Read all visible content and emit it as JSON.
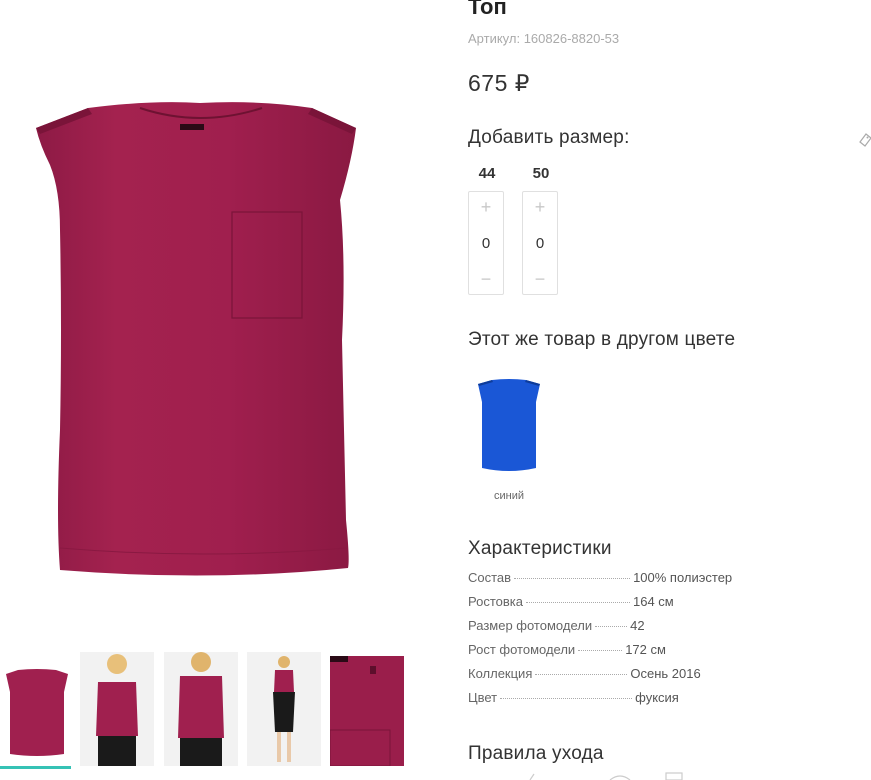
{
  "product": {
    "title": "Топ",
    "sku": "Артикул: 160826-8820-53",
    "price": "675 ₽"
  },
  "sizes": {
    "heading": "Добавить размер:",
    "items": [
      {
        "label": "44",
        "plus": "+",
        "value": "0",
        "minus": "−"
      },
      {
        "label": "50",
        "plus": "+",
        "value": "0",
        "minus": "−"
      }
    ]
  },
  "other_colors": {
    "heading": "Этот же товар в другом цвете",
    "items": [
      {
        "label": "синий",
        "color": "#1a57d6"
      }
    ]
  },
  "specs": {
    "heading": "Характеристики",
    "rows": [
      {
        "name": "Состав",
        "value": "100% полиэстер"
      },
      {
        "name": "Ростовка",
        "value": "164 см"
      },
      {
        "name": "Размер фотомодели",
        "value": "42"
      },
      {
        "name": "Рост фотомодели",
        "value": "172 см"
      },
      {
        "name": "Коллекция",
        "value": "Осень 2016"
      },
      {
        "name": "Цвет",
        "value": "фуксия"
      }
    ]
  },
  "care": {
    "heading": "Правила ухода"
  },
  "colors": {
    "product": "#a0204f",
    "accent": "#35c2b5",
    "variant_blue": "#1a57d6"
  },
  "icons": {
    "tag": "tag-icon"
  }
}
